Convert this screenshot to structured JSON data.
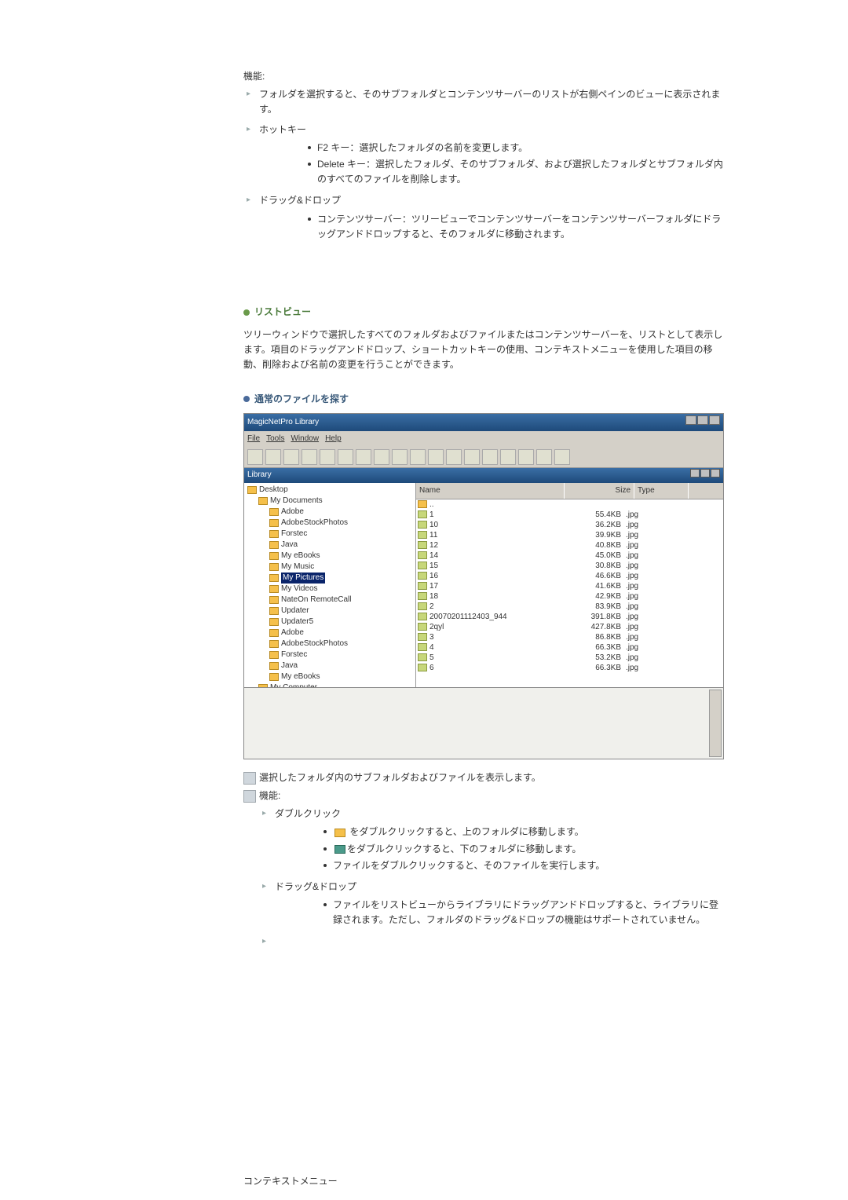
{
  "top": {
    "features_label": "機能:",
    "folder_select": "フォルダを選択すると、そのサブフォルダとコンテンツサーバーのリストが右側ペインのビューに表示されます。",
    "hotkey_label": "ホットキー",
    "hotkeys": [
      "F2 キー：選択したフォルダの名前を変更します。",
      "Delete キー：選択したフォルダ、そのサブフォルダ、および選択したフォルダとサブフォルダ内のすべてのファイルを削除します。"
    ],
    "dragdrop_label": "ドラッグ&ドロップ",
    "dragdrop_item": "コンテンツサーバー：ツリービューでコンテンツサーバーをコンテンツサーバーフォルダにドラッグアンドドロップすると、そのフォルダに移動されます。"
  },
  "listview": {
    "title": "リストビュー",
    "desc": "ツリーウィンドウで選択したすべてのフォルダおよびファイルまたはコンテンツサーバーを、リストとして表示します。項目のドラッグアンドドロップ、ショートカットキーの使用、コンテキストメニューを使用した項目の移動、削除および名前の変更を行うことができます。",
    "browse_title": "通常のファイルを探す"
  },
  "shot": {
    "title": "MagicNetPro Library",
    "menu": [
      "File",
      "Tools",
      "Window",
      "Help"
    ],
    "inner_title": "Library",
    "tree": [
      {
        "ind": 0,
        "txt": "Desktop"
      },
      {
        "ind": 1,
        "txt": "My Documents"
      },
      {
        "ind": 2,
        "txt": "Adobe"
      },
      {
        "ind": 2,
        "txt": "AdobeStockPhotos"
      },
      {
        "ind": 2,
        "txt": "Forstec"
      },
      {
        "ind": 2,
        "txt": "Java"
      },
      {
        "ind": 2,
        "txt": "My eBooks"
      },
      {
        "ind": 2,
        "txt": "My Music"
      },
      {
        "ind": 2,
        "txt": "My Pictures",
        "sel": true
      },
      {
        "ind": 2,
        "txt": "My Videos"
      },
      {
        "ind": 2,
        "txt": "NateOn RemoteCall"
      },
      {
        "ind": 2,
        "txt": "Updater"
      },
      {
        "ind": 2,
        "txt": "Updater5"
      },
      {
        "ind": 2,
        "txt": "Adobe"
      },
      {
        "ind": 2,
        "txt": "AdobeStockPhotos"
      },
      {
        "ind": 2,
        "txt": "Forstec"
      },
      {
        "ind": 2,
        "txt": "Java"
      },
      {
        "ind": 2,
        "txt": "My eBooks"
      },
      {
        "ind": 1,
        "txt": "My Computer"
      }
    ],
    "cols": {
      "name": "Name",
      "size": "Size",
      "type": "Type"
    },
    "rows": [
      {
        "n": "..",
        "s": "",
        "t": "",
        "up": true
      },
      {
        "n": "1",
        "s": "55.4KB",
        "t": ".jpg"
      },
      {
        "n": "10",
        "s": "36.2KB",
        "t": ".jpg"
      },
      {
        "n": "11",
        "s": "39.9KB",
        "t": ".jpg"
      },
      {
        "n": "12",
        "s": "40.8KB",
        "t": ".jpg"
      },
      {
        "n": "14",
        "s": "45.0KB",
        "t": ".jpg"
      },
      {
        "n": "15",
        "s": "30.8KB",
        "t": ".jpg"
      },
      {
        "n": "16",
        "s": "46.6KB",
        "t": ".jpg"
      },
      {
        "n": "17",
        "s": "41.6KB",
        "t": ".jpg"
      },
      {
        "n": "18",
        "s": "42.9KB",
        "t": ".jpg"
      },
      {
        "n": "2",
        "s": "83.9KB",
        "t": ".jpg"
      },
      {
        "n": "20070201112403_944",
        "s": "391.8KB",
        "t": ".jpg"
      },
      {
        "n": "2qyl",
        "s": "427.8KB",
        "t": ".jpg"
      },
      {
        "n": "3",
        "s": "86.8KB",
        "t": ".jpg"
      },
      {
        "n": "4",
        "s": "66.3KB",
        "t": ".jpg"
      },
      {
        "n": "5",
        "s": "53.2KB",
        "t": ".jpg"
      },
      {
        "n": "6",
        "s": "66.3KB",
        "t": ".jpg"
      }
    ]
  },
  "after": {
    "line1": "選択したフォルダ内のサブフォルダおよびファイルを表示します。",
    "features_label": "機能:",
    "dbl_label": "ダブルクリック",
    "dbl_items": [
      {
        "pre": "",
        "icon": "yellow",
        "post": " をダブルクリックすると、上のフォルダに移動します。"
      },
      {
        "pre": "",
        "icon": "teal",
        "post": "をダブルクリックすると、下のフォルダに移動します。"
      },
      {
        "pre": "ファイルをダブルクリックすると、そのファイルを実行します。",
        "icon": "",
        "post": ""
      }
    ],
    "dragdrop_label": "ドラッグ&ドロップ",
    "dragdrop_item": "ファイルをリストビューからライブラリにドラッグアンドドロップすると、ライブラリに登録されます。ただし、フォルダのドラッグ&ドロップの機能はサポートされていません。"
  },
  "ctx": {
    "title": "コンテキストメニュー"
  }
}
